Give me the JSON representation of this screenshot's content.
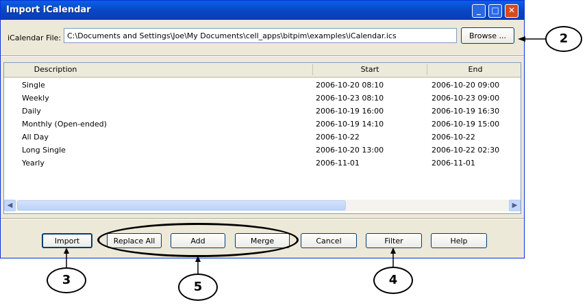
{
  "window": {
    "title": "Import iCalendar",
    "minimize": "_",
    "maximize": "□",
    "close": "✕"
  },
  "file": {
    "label": "iCalendar File:",
    "value": "C:\\Documents and Settings\\Joe\\My Documents\\cell_apps\\bitpim\\examples\\iCalendar.ics",
    "browse_label": "Browse ..."
  },
  "table": {
    "columns": [
      "Description",
      "Start",
      "End"
    ],
    "rows": [
      {
        "description": "Single",
        "start": "2006-10-20  08:10",
        "end": "2006-10-20  09:00"
      },
      {
        "description": "Weekly",
        "start": "2006-10-23  08:10",
        "end": "2006-10-23  09:00"
      },
      {
        "description": "Daily",
        "start": "2006-10-19  16:00",
        "end": "2006-10-19  16:30"
      },
      {
        "description": "Monthly (Open-ended)",
        "start": "2006-10-19  14:10",
        "end": "2006-10-19  15:00"
      },
      {
        "description": "All Day",
        "start": "2006-10-22",
        "end": "2006-10-22"
      },
      {
        "description": "Long Single",
        "start": "2006-10-20  13:00",
        "end": "2006-10-22  02:30"
      },
      {
        "description": "Yearly",
        "start": "2006-11-01",
        "end": "2006-11-01"
      }
    ]
  },
  "buttons": {
    "import": "Import",
    "replace_all": "Replace All",
    "add": "Add",
    "merge": "Merge",
    "cancel": "Cancel",
    "filter": "Filter",
    "help": "Help"
  },
  "callouts": {
    "browse": "2",
    "import": "3",
    "group": "5",
    "filter": "4"
  },
  "icons": {
    "scroll_left": "scroll-left-icon",
    "scroll_right": "scroll-right-icon"
  }
}
